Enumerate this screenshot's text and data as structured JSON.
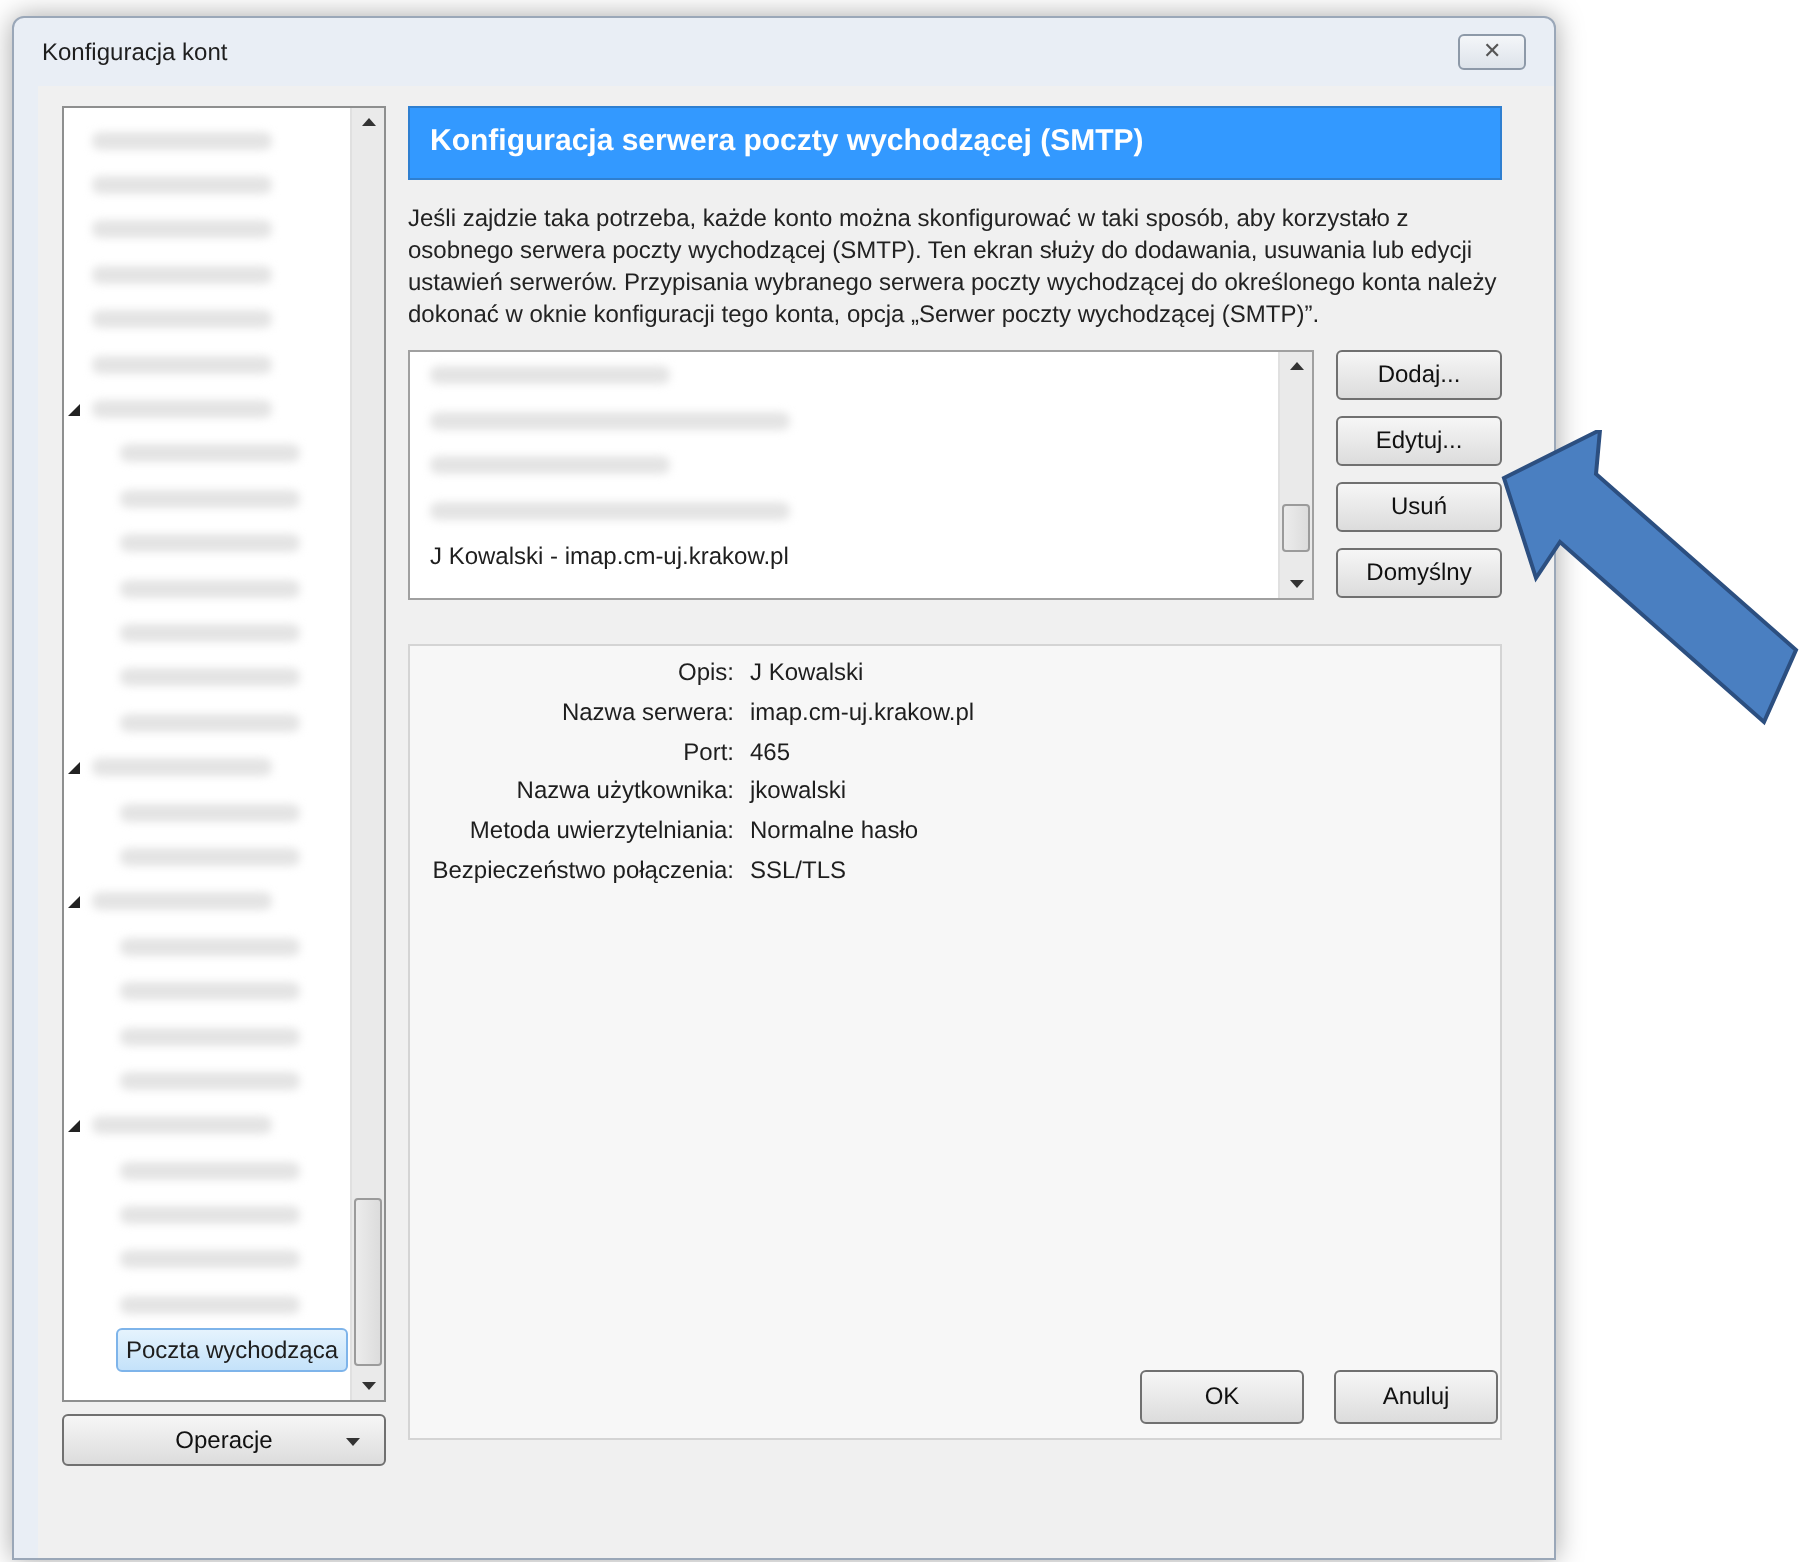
{
  "window": {
    "title": "Konfiguracja kont",
    "close": "✕"
  },
  "sidebar": {
    "tree": [
      {
        "kind": "blurred",
        "selected": false
      },
      {
        "kind": "blurred",
        "selected": false
      },
      {
        "kind": "blurred",
        "selected": false
      },
      {
        "kind": "blurred",
        "selected": false
      },
      {
        "kind": "blurred",
        "selected": false
      },
      {
        "kind": "blurred",
        "selected": false
      },
      {
        "kind": "blurred",
        "selected": false,
        "expanded": true,
        "children": [
          {
            "kind": "blurred",
            "selected": false
          },
          {
            "kind": "blurred",
            "selected": false
          },
          {
            "kind": "blurred",
            "selected": false
          },
          {
            "kind": "blurred",
            "selected": false
          },
          {
            "kind": "blurred",
            "selected": false
          },
          {
            "kind": "blurred",
            "selected": false
          },
          {
            "kind": "blurred",
            "selected": false
          }
        ]
      },
      {
        "kind": "blurred",
        "selected": false,
        "expanded": true,
        "children": [
          {
            "kind": "blurred",
            "selected": false
          },
          {
            "kind": "blurred",
            "selected": false
          }
        ]
      },
      {
        "kind": "blurred",
        "selected": false,
        "expanded": true,
        "children": [
          {
            "kind": "blurred",
            "selected": false
          },
          {
            "kind": "blurred",
            "selected": false
          },
          {
            "kind": "blurred",
            "selected": false
          },
          {
            "kind": "blurred",
            "selected": false
          }
        ]
      },
      {
        "kind": "blurred",
        "selected": false,
        "expanded": true,
        "children": [
          {
            "kind": "blurred",
            "selected": false
          },
          {
            "kind": "blurred",
            "selected": false
          },
          {
            "kind": "blurred",
            "selected": false
          },
          {
            "kind": "blurred",
            "selected": false
          },
          {
            "kind": "page",
            "label": "Poczta wychodząca",
            "selected": true
          }
        ]
      }
    ],
    "operations_button": "Operacje"
  },
  "panel": {
    "header": "Konfiguracja serwera poczty wychodzącej (SMTP)",
    "description": "Jeśli zajdzie taka potrzeba, każde konto można skonfigurować w taki sposób, aby korzystało z osobnego serwera poczty wychodzącej (SMTP). Ten ekran służy do dodawania, usuwania lub edycji ustawień serwerów. Przypisania wybranego serwera poczty wychodzącej do określonego konta należy dokonać w oknie konfiguracji tego konta, opcja „Serwer poczty wychodzącej (SMTP)”.",
    "servers": [
      {
        "kind": "blurred",
        "selected": false
      },
      {
        "kind": "blurred",
        "selected": false
      },
      {
        "kind": "blurred",
        "selected": false
      },
      {
        "kind": "blurred",
        "selected": false
      },
      {
        "kind": "server",
        "label": "J Kowalski - imap.cm-uj.krakow.pl",
        "selected": false
      }
    ],
    "buttons": [
      "Dodaj...",
      "Edytuj...",
      "Usuń",
      "Domyślny"
    ],
    "details": [
      {
        "label": "Opis:",
        "value": "J Kowalski"
      },
      {
        "label": "Nazwa serwera:",
        "value": "imap.cm-uj.krakow.pl"
      },
      {
        "label": "Port:",
        "value": "465"
      },
      {
        "label": "Nazwa użytkownika:",
        "value": "jkowalski"
      },
      {
        "label": "Metoda uwierzytelniania:",
        "value": "Normalne hasło"
      },
      {
        "label": "Bezpieczeństwo połączenia:",
        "value": "SSL/TLS"
      }
    ]
  },
  "footer": {
    "buttons": [
      "OK",
      "Anuluj"
    ]
  }
}
